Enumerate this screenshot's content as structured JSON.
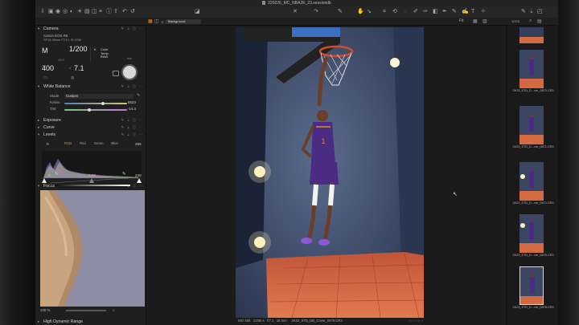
{
  "window": {
    "title": "220226_MC_NBA2K_23.sessiondb"
  },
  "toolbar2": {
    "layer_value": "Background",
    "fit_label": "Fit"
  },
  "tools": {
    "camera": {
      "title": "Camera",
      "model": "Canon EOS R5",
      "lens": "RF15-35mm F2.8 L IS USM",
      "mode": "M",
      "exposure_comp": "±0.0",
      "shutter": "1/200",
      "color_temp_label": "Color Temp.",
      "raw_label": "RAW",
      "iso": "400",
      "iso_label": "ISO",
      "aperture": "7.1",
      "aperture_prefix": "f/",
      "meta_label": "bat"
    },
    "white_balance": {
      "title": "White Balance",
      "mode_label": "Mode",
      "mode_value": "Custom",
      "kelvin_label": "Kelvin",
      "kelvin_value": "5523",
      "kelvin_fraction": 0.62,
      "tint_label": "Tint",
      "tint_value": "-14.3",
      "tint_fraction": 0.4
    },
    "exposure": {
      "title": "Exposure"
    },
    "curve": {
      "title": "Curve"
    },
    "levels": {
      "title": "Levels",
      "channels": [
        "RGB",
        "Red",
        "Green",
        "Blue"
      ],
      "active_channel": "RGB",
      "input_low": "0",
      "input_high": "255",
      "output_low": "2",
      "output_mid": "0.00",
      "output_high": "248"
    },
    "focus": {
      "title": "Focus",
      "zoom": "100 %"
    },
    "hdr": {
      "title": "High Dynamic Range"
    }
  },
  "viewer": {
    "iso": "ISO 400",
    "shutter": "1/200 s",
    "aperture": "f/7.1",
    "focal": "16 mm",
    "filename": "2K23_STD_DB_Cover_0879.CR3"
  },
  "browser": {
    "zoom_label": "1/375",
    "thumbs": [
      {
        "caption": ""
      },
      {
        "caption": "2K23_STD_D...ver_0870.CR3"
      },
      {
        "caption": "2K23_STD_D...ver_0871.CR3"
      },
      {
        "caption": "2K23_STD_D...ver_0872.CR3"
      },
      {
        "caption": "2K23_STD_D...ver_0876.CR3"
      },
      {
        "caption": "2K23_STD_D...ver_0878.CR3"
      }
    ]
  },
  "colors": {
    "accent": "#e08b2a",
    "panel": "#1f1f1f",
    "kelvin_track": "#6fa3d8",
    "tint_track": "#9bd17a"
  }
}
